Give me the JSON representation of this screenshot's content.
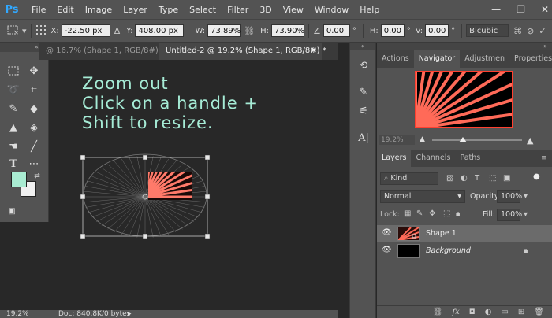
{
  "app": {
    "logo": "Ps"
  },
  "menu": [
    "File",
    "Edit",
    "Image",
    "Layer",
    "Type",
    "Select",
    "Filter",
    "3D",
    "View",
    "Window",
    "Help"
  ],
  "window_controls": {
    "minimize": "—",
    "restore": "❐",
    "close": "✕"
  },
  "options_bar": {
    "x_label": "X:",
    "x_value": "-22.50 px",
    "y_label": "Y:",
    "y_value": "408.00 px",
    "w_label": "W:",
    "w_value": "73.89%",
    "h_label": "H:",
    "h_value": "73.90%",
    "angle_value": "0.00",
    "angle_unit": "°",
    "hskew_label": "H:",
    "hskew_value": "0.00",
    "vskew_label": "V:",
    "vskew_value": "0.00",
    "interpolation": "Bicubic"
  },
  "tabs": {
    "doc1": "@ 16.7% (Shape 1, RGB/8#) *",
    "doc2": "Untitled-2 @ 19.2% (Shape 1, RGB/8#) *"
  },
  "canvas": {
    "line1": "Zoom out",
    "line2": "Click on a handle +",
    "line3": "Shift to resize."
  },
  "status": {
    "zoom": "19.2%",
    "doc": "Doc: 840.8K/0 bytes"
  },
  "panels": {
    "top_tabs": [
      "Actions",
      "Navigator",
      "Adjustmen",
      "Properties"
    ],
    "active_top_tab": "Navigator",
    "navigator_zoom": "19.2%",
    "layers_tabs": [
      "Layers",
      "Channels",
      "Paths"
    ],
    "active_layers_tab": "Layers",
    "kind_label": "Kind",
    "blend_mode": "Normal",
    "opacity_label": "Opacity:",
    "opacity_value": "100%",
    "lock_label": "Lock:",
    "fill_label": "Fill:",
    "fill_value": "100%",
    "layers": [
      {
        "name": "Shape 1"
      },
      {
        "name": "Background"
      }
    ]
  },
  "colors": {
    "foreground": "#a9ecd2",
    "background": "#f0f0f0",
    "canvas_text": "#a6ecd6",
    "accent_red": "#ff4030"
  },
  "icons": {
    "tools": [
      "marquee-icon",
      "move-icon",
      "lasso-icon",
      "crop-icon",
      "brush-icon",
      "eraser-icon",
      "stamp-icon",
      "bucket-icon",
      "smudge-icon",
      "pen-icon",
      "type-icon",
      "path-select-icon"
    ]
  }
}
